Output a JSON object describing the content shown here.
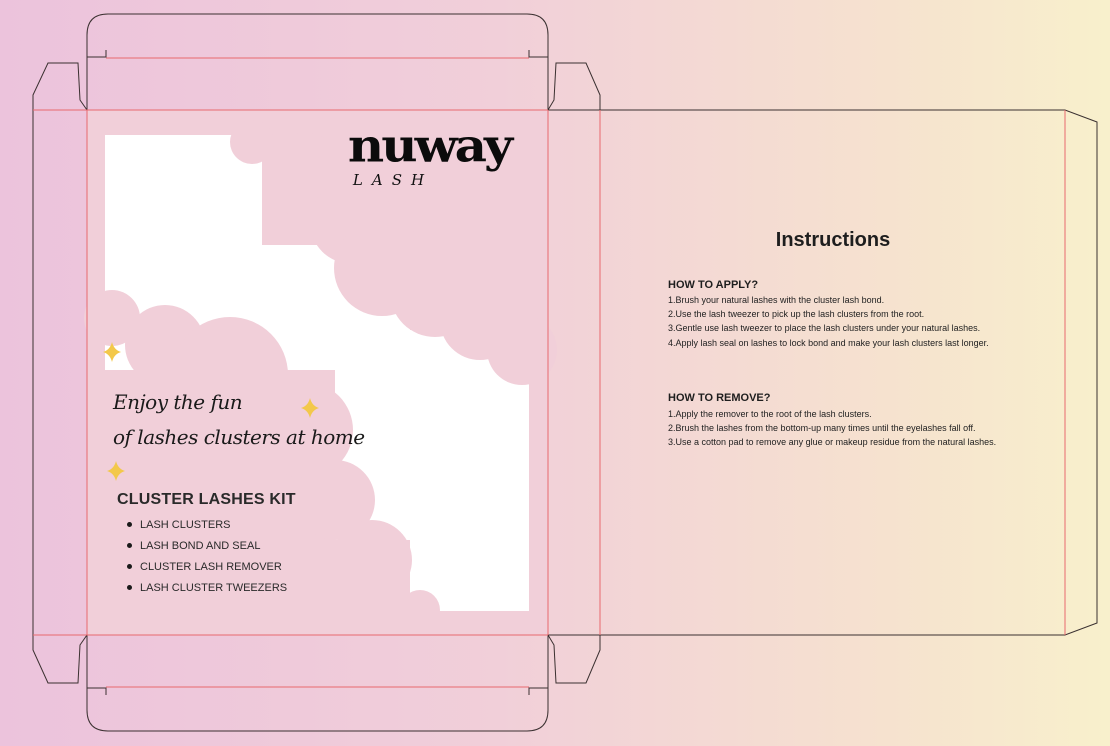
{
  "brand": {
    "name": "nuway",
    "sub": "LASH"
  },
  "tagline": {
    "line1": "Enjoy the fun",
    "line2": "of lashes clusters at home"
  },
  "kit": {
    "title": "CLUSTER LASHES KIT",
    "items": [
      "LASH CLUSTERS",
      "LASH BOND AND SEAL",
      "CLUSTER LASH REMOVER",
      "LASH CLUSTER TWEEZERS"
    ]
  },
  "instructions": {
    "title": "Instructions",
    "apply": {
      "heading": "HOW TO APPLY?",
      "steps": [
        "1.Brush your natural lashes with the cluster lash bond.",
        "2.Use the lash tweezer to pick up the lash clusters from the root.",
        "3.Gentle use lash tweezer to place the lash clusters under your natural lashes.",
        "4.Apply lash seal on lashes to lock bond and make your lash clusters last longer."
      ]
    },
    "remove": {
      "heading": "HOW TO REMOVE?",
      "steps": [
        "1.Apply the remover to the root of the lash clusters.",
        "2.Brush the lashes from the bottom-up many times until the eyelashes fall off.",
        "3.Use a cotton pad to remove any glue or makeup residue from the natural lashes."
      ]
    }
  },
  "colors": {
    "cut_line": "#3a3030",
    "fold_line": "#e8696e",
    "panel_pink": "#f1cfd9",
    "cloud_pink": "#f0c7d8",
    "window_white": "#ffffff",
    "sparkle": "#f3c84a",
    "text": "#1e1e1e"
  }
}
